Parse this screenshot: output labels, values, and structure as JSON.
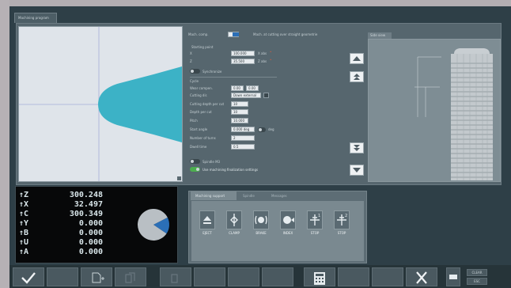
{
  "top_tab": {
    "label": "Machining program"
  },
  "graphic": {},
  "form": {
    "row1_label": "Mach. comp.",
    "row1_value": "",
    "row1_right_label": "Mach. at cutting over straight geometrie",
    "start_label": "Starting point",
    "x_label": "X",
    "x_value": "100.000",
    "x_unit": "X abs",
    "z_label": "Z",
    "z_value": "35.500",
    "z_unit": "Z abs",
    "toggle1_label": "Synchronize",
    "group_label": "Cycle",
    "wear_label": "Wear compen.",
    "wear_value1": "0.00",
    "wear_value2": "0.00",
    "direction_label": "Cutting dir.",
    "direction_value": "Down external",
    "cut_label": "Cutting depth per cut",
    "cut_value": "10",
    "depth_label": "Depth per cut",
    "depth_value": "10",
    "pitch_label": "Pitch",
    "pitch_value": "10.000",
    "angle_label": "Start angle",
    "angle_value": "0.000 deg",
    "angle_unit": "deg",
    "turns_label": "Number of turns",
    "turns_value": "2",
    "dwell_label": "Dwell time",
    "dwell_value": "0.5",
    "toggle2_label": "Spindle M3",
    "toggle3_label": "Use machining finalization settings"
  },
  "side_panel": {
    "tab_label": "Side view"
  },
  "dro": {
    "rows": [
      {
        "axis": "↑Z",
        "value": "300.248"
      },
      {
        "axis": "↑X",
        "value": "32.497"
      },
      {
        "axis": "↑C",
        "value": "300.349"
      },
      {
        "axis": "↑Y",
        "value": "0.000"
      },
      {
        "axis": "↑B",
        "value": "0.000"
      },
      {
        "axis": "↑U",
        "value": "0.000"
      },
      {
        "axis": "↑A",
        "value": "0.000"
      }
    ],
    "chart_data": {
      "type": "pie",
      "values": [
        0.17,
        0.83
      ],
      "colors": [
        "#2b6fb7",
        "#b9bfc4"
      ]
    }
  },
  "function_panel": {
    "tabs": [
      "Machining support",
      "Spindle",
      "Messages"
    ],
    "tools": [
      {
        "icon": "eject-icon",
        "label": "EJECT"
      },
      {
        "icon": "clamp-icon",
        "label": "CLAMP"
      },
      {
        "icon": "brake-icon",
        "label": "BRAKE"
      },
      {
        "icon": "index-icon",
        "label": "INDEX"
      },
      {
        "icon": "stop-1-icon",
        "label": "STOP"
      },
      {
        "icon": "stop-2-icon",
        "label": "STOP"
      }
    ]
  },
  "bottom_bar": {
    "mini1": "CLEAR",
    "mini2": "ESC"
  },
  "colors": {
    "accent": "#3cb2c6",
    "toggle_on": "#4cae4f",
    "screen_bg": "#2e3f47"
  }
}
